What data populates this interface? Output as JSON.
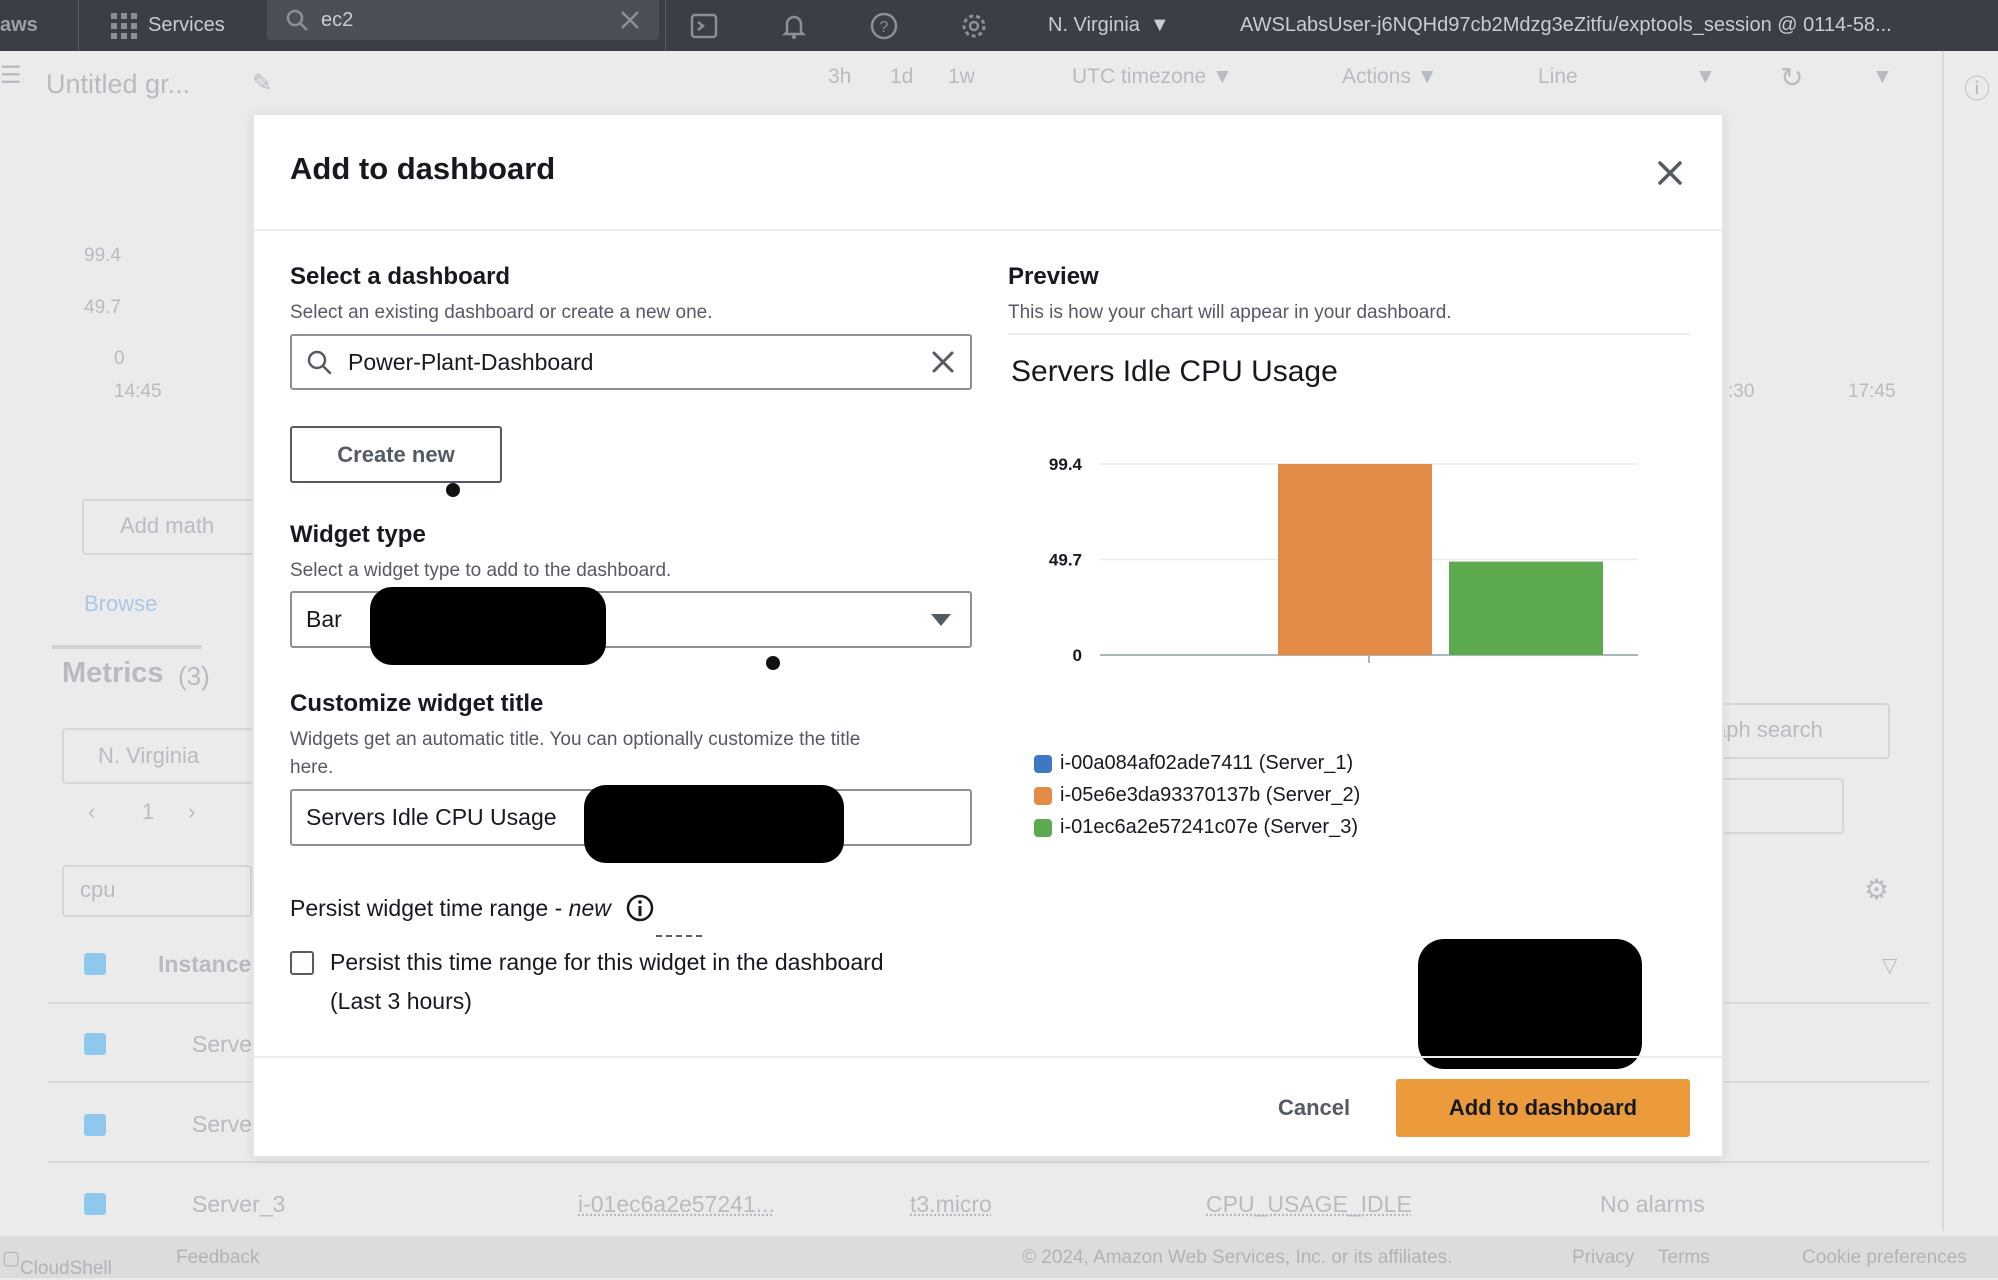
{
  "topnav": {
    "logo": "aws",
    "services": "Services",
    "search_value": "ec2",
    "region": "N. Virginia",
    "account": "AWSLabsUser-j6NQHd97cb2Mdzg3eZitfu/exptools_session @ 0114-58..."
  },
  "background": {
    "graph_title": "Untitled gr...",
    "time_3h": "3h",
    "time_1d": "1d",
    "time_1w": "1w",
    "timezone": "UTC timezone",
    "actions": "Actions",
    "chart_type": "Line",
    "y_ticks": [
      "99.4",
      "49.7",
      "0"
    ],
    "x_tick_left": "14:45",
    "x_tick_right_1": ":30",
    "x_tick_right_2": "17:45",
    "add_math": "Add math",
    "browse_tab": "Browse",
    "metrics_title": "Metrics",
    "metrics_count": "(3)",
    "region_filter": "N. Virginia",
    "page_number": "1",
    "search_token": "cpu",
    "graph_search": "aph search",
    "col_instance": "Instance",
    "rows": [
      {
        "name": "Serve"
      },
      {
        "name": "Serve"
      },
      {
        "name": "Server_3",
        "id": "i-01ec6a2e57241...",
        "type": "t3.micro",
        "metric": "CPU_USAGE_IDLE",
        "alarms": "No alarms"
      }
    ]
  },
  "footer": {
    "cloudshell": "CloudShell",
    "feedback": "Feedback",
    "copyright": "© 2024, Amazon Web Services, Inc. or its affiliates.",
    "privacy": "Privacy",
    "terms": "Terms",
    "cookies": "Cookie preferences"
  },
  "modal": {
    "title": "Add to dashboard",
    "select_dashboard_label": "Select a dashboard",
    "select_dashboard_desc": "Select an existing dashboard or create a new one.",
    "dashboard_value": "Power-Plant-Dashboard",
    "create_new": "Create new",
    "widget_type_label": "Widget type",
    "widget_type_desc": "Select a widget type to add to the dashboard.",
    "widget_type_value": "Bar",
    "customize_title_label": "Customize widget title",
    "customize_title_desc_1": "Widgets get an automatic title. You can optionally customize the title",
    "customize_title_desc_2": "here.",
    "widget_title_value": "Servers Idle CPU Usage",
    "persist_label": "Persist widget time range - ",
    "persist_new": "new",
    "persist_checkbox_1": "Persist this time range for this widget in the dashboard",
    "persist_checkbox_2": "(Last 3 hours)",
    "preview_label": "Preview",
    "preview_desc": "This is how your chart will appear in your dashboard.",
    "cancel": "Cancel",
    "add": "Add to dashboard"
  },
  "colors": {
    "accent": "#eb9b3c",
    "server1": "#3d78c2",
    "server2": "#e38b48",
    "server3": "#5da950"
  },
  "chart_data": {
    "type": "bar",
    "title": "Servers Idle CPU Usage",
    "categories": [
      "Server_1",
      "Server_2",
      "Server_3"
    ],
    "series": [
      {
        "name": "i-00a084af02ade7411 (Server_1)",
        "values": [
          0
        ]
      },
      {
        "name": "i-05e6e3da93370137b (Server_2)",
        "values": [
          99.4
        ]
      },
      {
        "name": "i-01ec6a2e57241c07e (Server_3)",
        "values": [
          48.6
        ]
      }
    ],
    "y_ticks": [
      "99.4",
      "49.7",
      "0"
    ],
    "ylim": [
      0,
      99.4
    ],
    "legend_position": "bottom"
  }
}
